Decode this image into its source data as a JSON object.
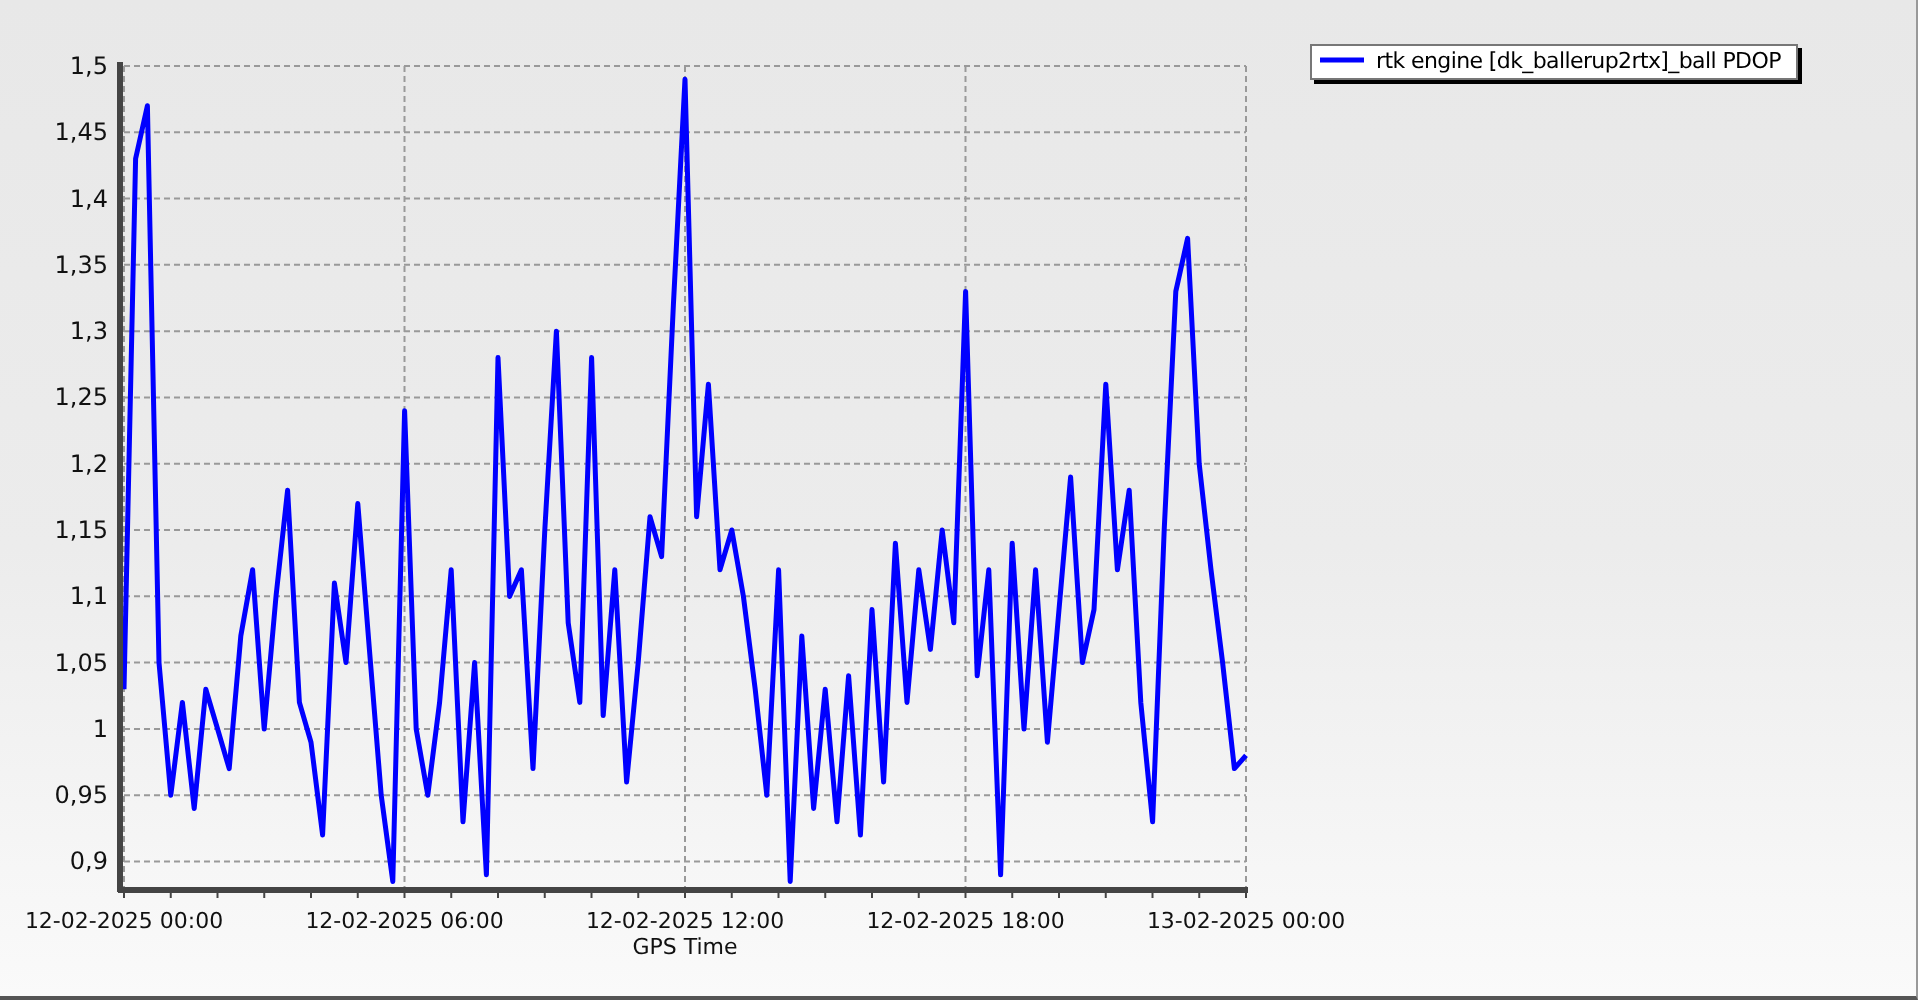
{
  "chart": {
    "chart_data": {
      "type": "line",
      "grid": true,
      "xlabel": "GPS Time",
      "categories": [
        "12-02-2025 00:00",
        null,
        null,
        null,
        null,
        null,
        null,
        null,
        null,
        null,
        null,
        null,
        null,
        null,
        null,
        null,
        null,
        null,
        null,
        null,
        null,
        null,
        null,
        null,
        "12-02-2025 06:00",
        null,
        null,
        null,
        null,
        null,
        null,
        null,
        null,
        null,
        null,
        null,
        null,
        null,
        null,
        null,
        null,
        null,
        null,
        null,
        null,
        null,
        null,
        null,
        "12-02-2025 12:00",
        null,
        null,
        null,
        null,
        null,
        null,
        null,
        null,
        null,
        null,
        null,
        null,
        null,
        null,
        null,
        null,
        null,
        null,
        null,
        null,
        null,
        null,
        null,
        "12-02-2025 18:00",
        null,
        null,
        null,
        null,
        null,
        null,
        null,
        null,
        null,
        null,
        null,
        null,
        null,
        null,
        null,
        null,
        null,
        null,
        null,
        null,
        null,
        null,
        null,
        "13-02-2025 00:00"
      ],
      "series": [
        {
          "name": "rtk engine [dk_ballerup2rtx]_ball PDOP",
          "color": "#0000ff",
          "values": [
            1.03,
            1.43,
            1.47,
            1.05,
            0.95,
            1.02,
            0.94,
            1.03,
            1.0,
            0.97,
            1.07,
            1.12,
            1.0,
            1.1,
            1.18,
            1.02,
            0.99,
            0.92,
            1.11,
            1.05,
            1.17,
            1.06,
            0.95,
            0.885,
            1.24,
            1.0,
            0.95,
            1.02,
            1.12,
            0.93,
            1.05,
            0.89,
            1.28,
            1.1,
            1.12,
            0.97,
            1.15,
            1.3,
            1.08,
            1.02,
            1.28,
            1.01,
            1.12,
            0.96,
            1.05,
            1.16,
            1.13,
            1.32,
            1.49,
            1.16,
            1.26,
            1.12,
            1.15,
            1.1,
            1.03,
            0.95,
            1.12,
            0.885,
            1.07,
            0.94,
            1.03,
            0.93,
            1.04,
            0.92,
            1.09,
            0.96,
            1.14,
            1.02,
            1.12,
            1.06,
            1.15,
            1.08,
            1.33,
            1.04,
            1.12,
            0.89,
            1.14,
            1.0,
            1.12,
            0.99,
            1.09,
            1.19,
            1.05,
            1.09,
            1.26,
            1.12,
            1.18,
            1.02,
            0.93,
            1.15,
            1.33,
            1.37,
            1.2,
            1.12,
            1.05,
            0.97,
            0.98
          ]
        }
      ],
      "ylim": [
        0.88,
        1.5
      ],
      "yticks": [
        {
          "value": 0.9,
          "label": "0,9"
        },
        {
          "value": 0.95,
          "label": "0,95"
        },
        {
          "value": 1,
          "label": "1"
        },
        {
          "value": 1.05,
          "label": "1,05"
        },
        {
          "value": 1.1,
          "label": "1,1"
        },
        {
          "value": 1.15,
          "label": "1,15"
        },
        {
          "value": 1.2,
          "label": "1,2"
        },
        {
          "value": 1.25,
          "label": "1,25"
        },
        {
          "value": 1.3,
          "label": "1,3"
        },
        {
          "value": 1.35,
          "label": "1,35"
        },
        {
          "value": 1.4,
          "label": "1,4"
        },
        {
          "value": 1.45,
          "label": "1,45"
        },
        {
          "value": 1.5,
          "label": "1,5"
        }
      ]
    }
  }
}
